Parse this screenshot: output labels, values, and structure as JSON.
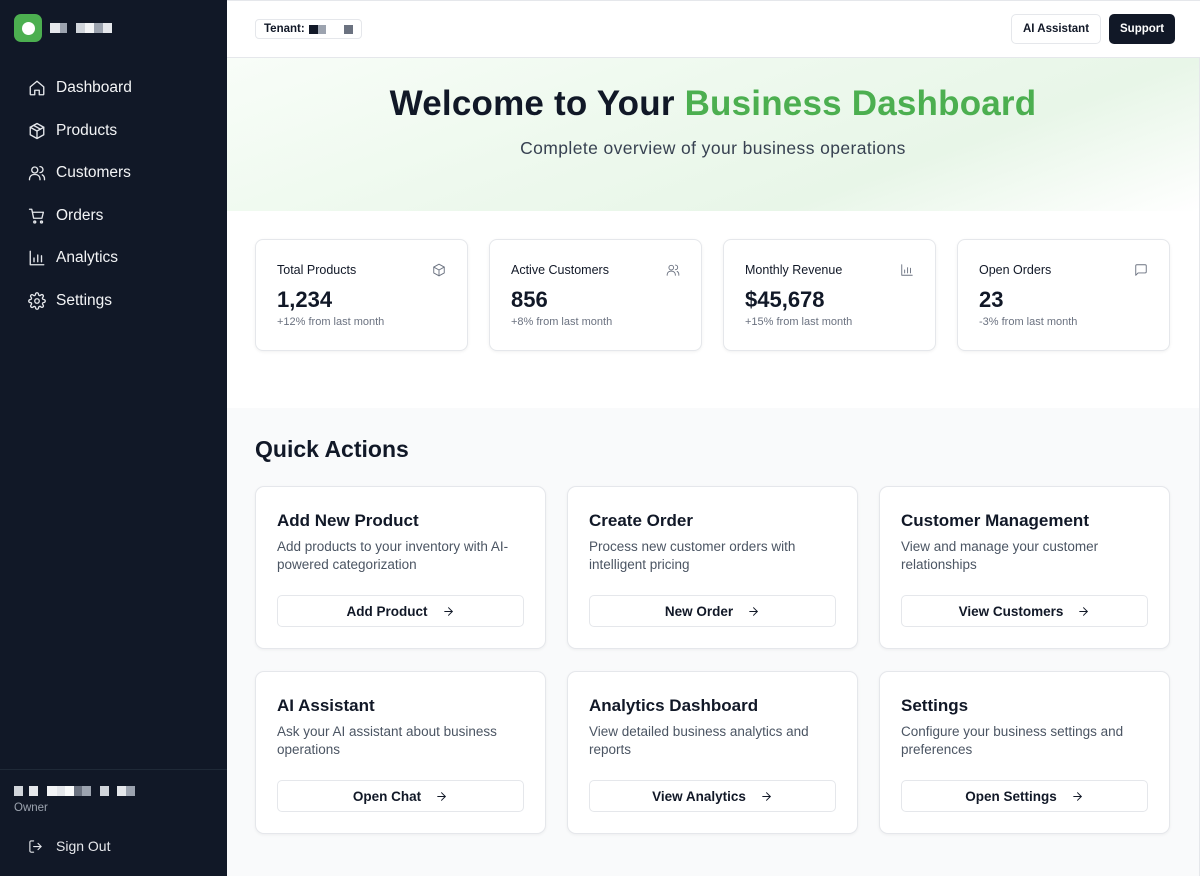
{
  "sidebar": {
    "brand_icon": "app-logo-icon",
    "nav": [
      {
        "label": "Dashboard",
        "icon": "home-icon"
      },
      {
        "label": "Products",
        "icon": "package-icon"
      },
      {
        "label": "Customers",
        "icon": "users-icon"
      },
      {
        "label": "Orders",
        "icon": "cart-icon"
      },
      {
        "label": "Analytics",
        "icon": "bar-chart-icon"
      },
      {
        "label": "Settings",
        "icon": "gear-icon"
      }
    ],
    "user_role": "Owner",
    "sign_out_label": "Sign Out"
  },
  "topbar": {
    "tenant_label": "Tenant:",
    "ai_assistant_label": "AI Assistant",
    "support_label": "Support"
  },
  "hero": {
    "title_prefix": "Welcome to Your ",
    "title_accent": "Business Dashboard",
    "subtitle": "Complete overview of your business operations"
  },
  "stats": [
    {
      "label": "Total Products",
      "value": "1,234",
      "change": "+12% from last month",
      "icon": "package-icon"
    },
    {
      "label": "Active Customers",
      "value": "856",
      "change": "+8% from last month",
      "icon": "users-icon"
    },
    {
      "label": "Monthly Revenue",
      "value": "$45,678",
      "change": "+15% from last month",
      "icon": "bar-chart-icon"
    },
    {
      "label": "Open Orders",
      "value": "23",
      "change": "-3% from last month",
      "icon": "message-icon"
    }
  ],
  "quick_actions": {
    "heading": "Quick Actions",
    "cards": [
      {
        "title": "Add New Product",
        "description": "Add products to your inventory with AI-powered categorization",
        "button": "Add Product"
      },
      {
        "title": "Create Order",
        "description": "Process new customer orders with intelligent pricing",
        "button": "New Order"
      },
      {
        "title": "Customer Management",
        "description": "View and manage your customer relationships",
        "button": "View Customers"
      },
      {
        "title": "AI Assistant",
        "description": "Ask your AI assistant about business operations",
        "button": "Open Chat"
      },
      {
        "title": "Analytics Dashboard",
        "description": "View detailed business analytics and reports",
        "button": "View Analytics"
      },
      {
        "title": "Settings",
        "description": "Configure your business settings and preferences",
        "button": "Open Settings"
      }
    ]
  },
  "colors": {
    "sidebar_bg": "#111827",
    "accent": "#4caf50",
    "text": "#111827",
    "muted": "#6b7280"
  }
}
